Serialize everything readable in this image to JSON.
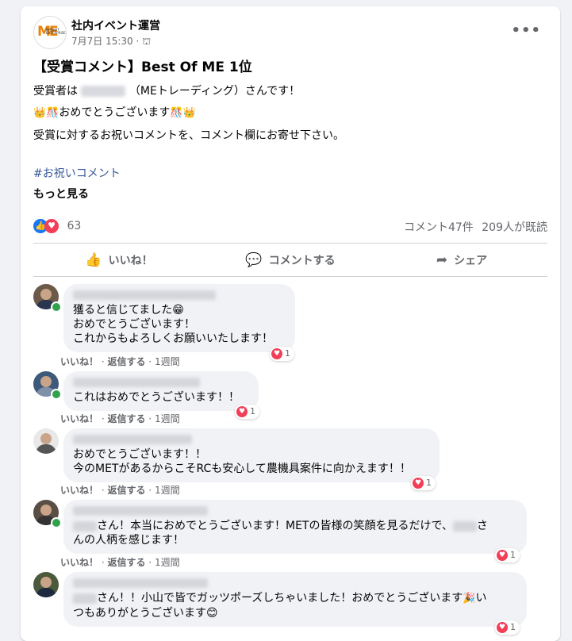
{
  "post": {
    "group_name": "社内イベント運営",
    "date": "7月7日 15:30",
    "meta_sep": "·",
    "more_label": "•••",
    "title": "【受賞コメント】Best Of ME 1位",
    "line1_pre": "受賞者は",
    "line1_post": "（MEトレーディング）さんです！",
    "line2": "おめでとうございます",
    "line3": "受賞に対するお祝いコメントを、コメント欄にお寄せ下さい。",
    "hashtag": "#お祝いコメント",
    "see_more": "もっと見る",
    "reaction_count": "63",
    "comments_count": "コメント47件",
    "seen_count": "209人が既読"
  },
  "actions": {
    "like": "いいね！",
    "comment": "コメントする",
    "share": "シェア"
  },
  "comments": [
    {
      "lines": [
        "獲ると信じてました😁",
        "おめでとうございます！",
        "これからもよろしくお願いいたします！"
      ],
      "hearts": "1"
    },
    {
      "lines": [
        "これはおめでとうございます！！"
      ],
      "hearts": "1"
    },
    {
      "lines": [
        "おめでとうございます！！",
        "今のMETがあるからこそRCも安心して農機具案件に向かえます！！"
      ],
      "hearts": "1"
    },
    {
      "line1": "さん！本当におめでとうございます！METの皆様の笑顔を見るだけで、",
      "line1_end": "さ",
      "line2": "んの人柄を感じます！",
      "hearts": "1"
    },
    {
      "line1": "さん！！小山で皆でガッツポーズしちゃいました！おめでとうございます",
      "line1_end": "い",
      "line2": "つもありがとうございます😊",
      "hearts": "1"
    }
  ],
  "comment_footer": {
    "like": "いいね！",
    "reply": "返信する",
    "time": "1週間"
  },
  "colors": {
    "accent": "#385898",
    "heart": "#f33e58",
    "like": "#1877f2"
  }
}
